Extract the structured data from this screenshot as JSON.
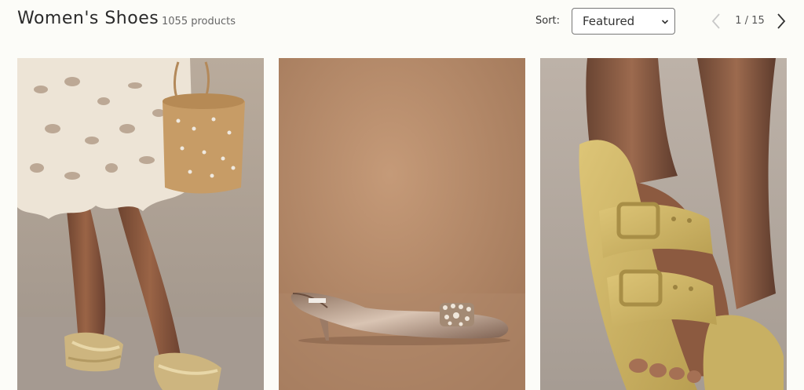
{
  "header": {
    "title": "Women's Shoes",
    "product_count": "1055 products"
  },
  "sort": {
    "label": "Sort:",
    "selected": "Featured"
  },
  "pagination": {
    "current": "1",
    "separator": "/",
    "total": "15",
    "text": "1 / 15"
  },
  "products": [
    {
      "image": "woven-strap-slide-sandal-gold"
    },
    {
      "image": "metallic-embellished-kitten-heel-mule"
    },
    {
      "image": "yellow-double-buckle-slide-sandal"
    }
  ],
  "colors": {
    "background": "#fcfcf8",
    "text": "#2b2b2b"
  }
}
